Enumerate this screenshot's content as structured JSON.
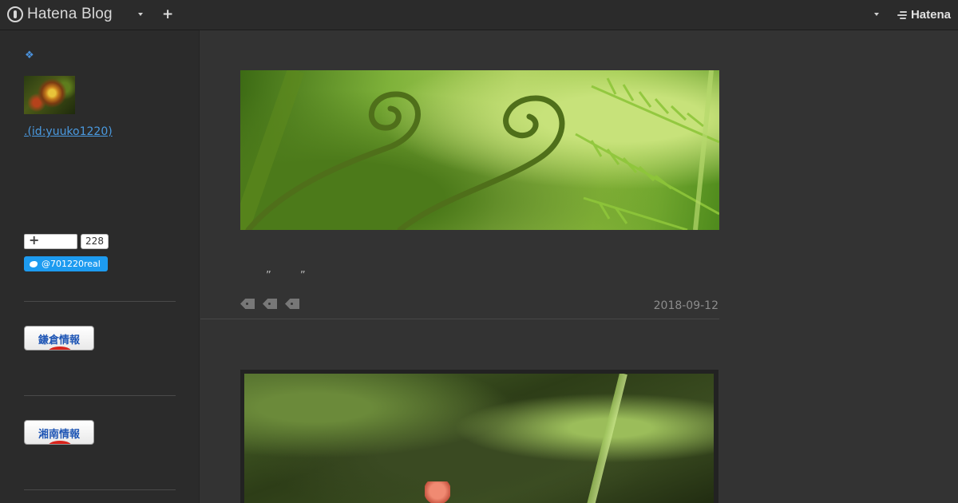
{
  "topbar": {
    "app_name": "Hatena Blog",
    "brand_right": "Hatena",
    "icons": [
      "hatena-blog-logo-icon",
      "chevron-down-icon",
      "plus-icon",
      "hatena-logo-icon"
    ]
  },
  "sidebar": {
    "diamond": "❖",
    "user_id_link": ".(id:yuuko1220)",
    "bookmark_count": "228",
    "twitter_handle": "@701220real",
    "banners": [
      {
        "label": "鎌倉情報"
      },
      {
        "label": "湘南情報"
      }
    ]
  },
  "post": {
    "quote_text": "” ”",
    "date": "2018-09-12",
    "tag_count": 3
  },
  "colors": {
    "background": "#333333",
    "panel": "#2b2b2b",
    "link": "#4a9ae0",
    "twitter": "#1d9bf0"
  }
}
